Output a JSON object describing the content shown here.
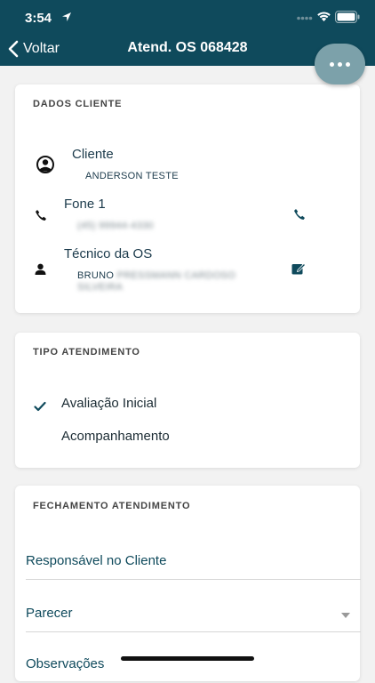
{
  "status_bar": {
    "time": "3:54"
  },
  "nav": {
    "back_label": "Voltar",
    "title": "Atend. OS 068428"
  },
  "dados_cliente": {
    "title": "DADOS CLIENTE",
    "cliente_label": "Cliente",
    "cliente_value": "ANDERSON TESTE",
    "fone_label": "Fone 1",
    "fone_value": "(45) 99944-4330",
    "tecnico_label": "Técnico da OS",
    "tecnico_value_line1": "BRUNO PRESSMANN CARDOSO",
    "tecnico_value_line2": "SILVEIRA"
  },
  "tipo_atendimento": {
    "title": "TIPO ATENDIMENTO",
    "options": [
      "Avaliação Inicial",
      "Acompanhamento"
    ],
    "selected": "Avaliação Inicial"
  },
  "fechamento": {
    "title": "FECHAMENTO ATENDIMENTO",
    "responsavel_label": "Responsável no Cliente",
    "parecer_label": "Parecer",
    "observacoes_label": "Observações"
  },
  "colors": {
    "header": "#0f4a5c",
    "fab": "#7ca1aa",
    "text": "#1b3a4b"
  }
}
